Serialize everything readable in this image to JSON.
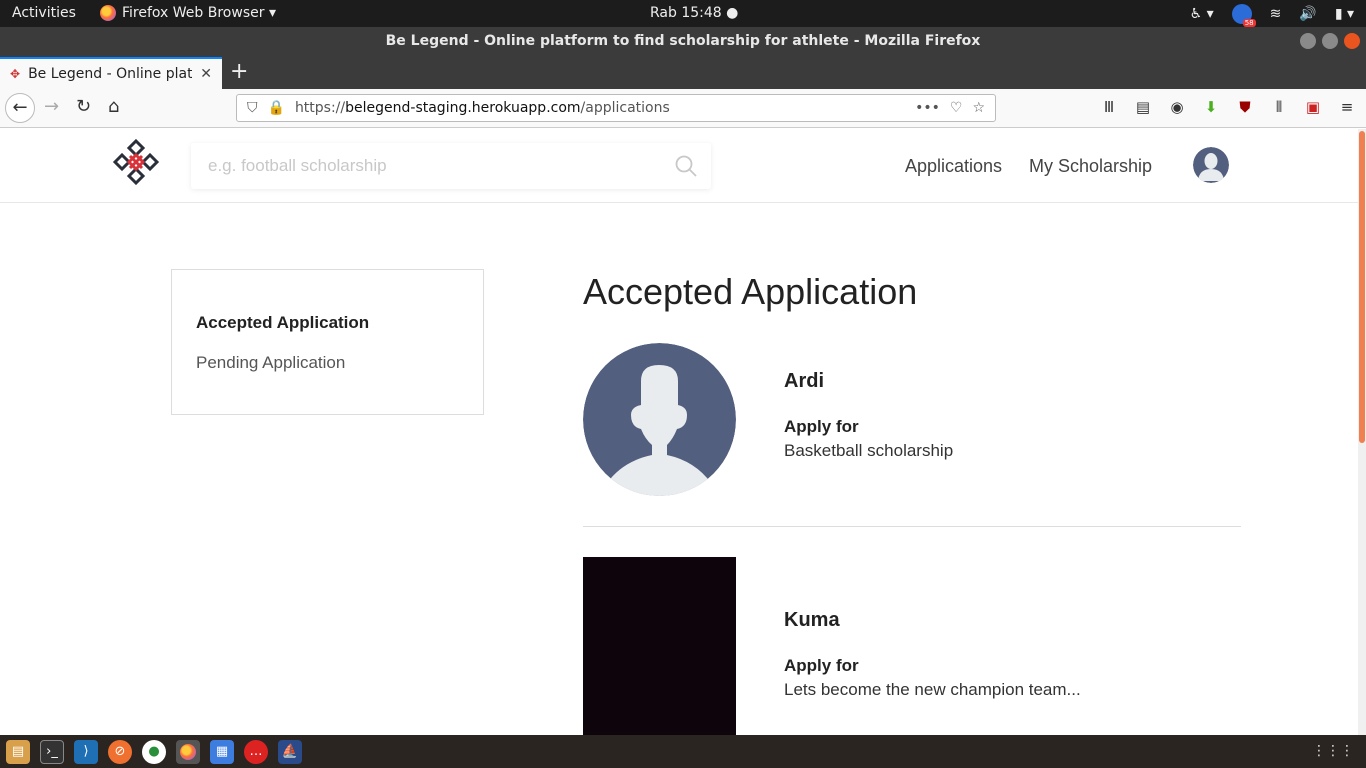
{
  "system": {
    "activities": "Activities",
    "app_menu": "Firefox Web Browser ▾",
    "clock": "Rab 15:48 ●"
  },
  "window": {
    "title": "Be Legend - Online platform to find scholarship for athlete - Mozilla Firefox"
  },
  "tab": {
    "title": "Be Legend - Online platform to find scholarship for athlete",
    "close": "✕",
    "new_tab": "+"
  },
  "address_bar": {
    "prefix": "https://",
    "host": "belegend-staging.herokuapp.com",
    "path": "/applications"
  },
  "site": {
    "search_placeholder": "e.g. football scholarship",
    "nav": {
      "applications": "Applications",
      "my_scholarship": "My Scholarship"
    }
  },
  "sidebar": {
    "items": [
      {
        "label": "Accepted Application",
        "active": true
      },
      {
        "label": "Pending Application",
        "active": false
      }
    ]
  },
  "main": {
    "title": "Accepted Application",
    "applications": [
      {
        "name": "Ardi",
        "apply_label": "Apply for",
        "scholarship": "Basketball scholarship",
        "photo": "default-avatar"
      },
      {
        "name": "Kuma",
        "apply_label": "Apply for",
        "scholarship": "Lets become the new champion team...",
        "photo": "dark-photo"
      }
    ]
  },
  "colors": {
    "accent": "#e85a2a",
    "avatar_bg": "#525f7f",
    "avatar_fg": "#e8ecee"
  }
}
